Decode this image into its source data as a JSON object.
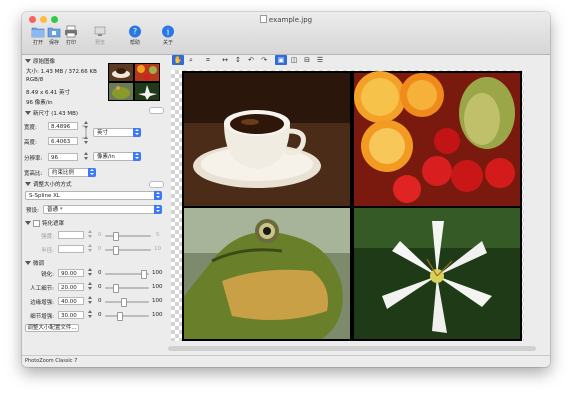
{
  "window": {
    "title": "example.jpg"
  },
  "colors": {
    "close": "#fc605c",
    "minimize": "#fdbc40",
    "zoom": "#34c84a",
    "accent": "#2f6bdb"
  },
  "toolbar": [
    {
      "label": "打开",
      "icon": "folder-icon"
    },
    {
      "label": "保存",
      "icon": "save-icon"
    },
    {
      "label": "打印",
      "icon": "printer-icon"
    },
    {
      "label": "预览",
      "icon": "preview-icon"
    },
    {
      "label": "帮助",
      "icon": "help-icon"
    },
    {
      "label": "关于",
      "icon": "info-icon"
    }
  ],
  "original": {
    "section_label": "原始图像",
    "size": "大小: 1.43 MB / 372.66 KB",
    "mode": "RGB/8",
    "dims": "8.49 x 6.41 英寸",
    "res": "96 像素/in"
  },
  "newsize": {
    "section_label": "新尺寸 (1.43 MB)",
    "width_label": "宽度:",
    "width_value": "8.4896",
    "height_label": "高度:",
    "height_value": "6.4063",
    "unit": "英寸",
    "resolution_label": "分辨率:",
    "resolution_value": "96",
    "resolution_unit": "像素/in",
    "ratio_label": "宽高比:",
    "ratio_value": "约束比例"
  },
  "method": {
    "section_label": "调整大小的方式",
    "algorithm": "S-Spline XL",
    "preset_label": "预设:",
    "preset_value": "普通 *"
  },
  "sharpen": {
    "section_label": "钝化遮罩",
    "strength_label": "强度:",
    "radius_label": "半径:",
    "min": "0",
    "strength_max": "5",
    "radius_max": "10"
  },
  "finetune": {
    "section_label": "微调",
    "rows": [
      {
        "label": "锐化:",
        "value": "90.00",
        "min": "0",
        "max": "100",
        "level": 0.9
      },
      {
        "label": "人工细节:",
        "value": "20.00",
        "min": "0",
        "max": "100",
        "level": 0.2
      },
      {
        "label": "边缘增强:",
        "value": "40.00",
        "min": "0",
        "max": "100",
        "level": 0.4
      },
      {
        "label": "细节增强:",
        "value": "30.00",
        "min": "0",
        "max": "100",
        "level": 0.3
      }
    ],
    "profile_button": "调整大小配置文件..."
  },
  "status": {
    "text": "PhotoZoom Classic 7"
  }
}
